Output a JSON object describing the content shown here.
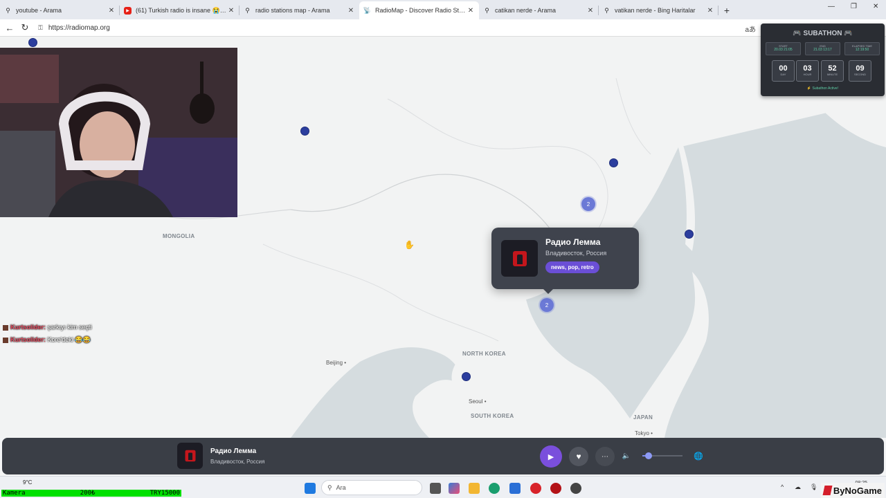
{
  "browser": {
    "tabs": [
      {
        "title": "youtube - Arama",
        "icon": "search-icon",
        "active": false
      },
      {
        "title": "(61) Turkish radio is insane 😭 - Yo",
        "icon": "youtube-icon",
        "active": false
      },
      {
        "title": "radio stations map - Arama",
        "icon": "search-icon",
        "active": false
      },
      {
        "title": "RadioMap - Discover Radio Stations",
        "icon": "radio-icon",
        "active": true
      },
      {
        "title": "catikan nerde - Arama",
        "icon": "search-icon",
        "active": false
      },
      {
        "title": "vatikan nerde - Bing Haritalar",
        "icon": "search-icon",
        "active": false
      }
    ],
    "url": "https://radiomap.org"
  },
  "map": {
    "labels": {
      "mongolia": "MONGOLIA",
      "north_korea": "NORTH KOREA",
      "south_korea": "SOUTH KOREA",
      "japan": "JAPAN",
      "beijing": "Beijing",
      "seoul": "Seoul",
      "tokyo": "Tokyo"
    },
    "clusters": [
      "2",
      "2"
    ]
  },
  "popup": {
    "station_name": "Радио Лемма",
    "location": "Владивосток, Россия",
    "tags": "news, pop, retro"
  },
  "chat": [
    {
      "user": "Kurtsolider:",
      "text": "şarkıyı kim seçti"
    },
    {
      "user": "Kurtsolider:",
      "text": "Kore'deki 😂😂"
    }
  ],
  "subathon": {
    "title": "SUBATHON",
    "start_label": "START",
    "start_value": "20.03 21:05",
    "end_label": "END",
    "end_value": "21.03 13:17",
    "elapsed_label": "ELAPSED TIME",
    "elapsed_value": "12:19:50",
    "counters": [
      {
        "value": "00",
        "unit": "DAY"
      },
      {
        "value": "03",
        "unit": "HOUR"
      },
      {
        "value": "52",
        "unit": "MINUTE"
      },
      {
        "value": "09",
        "unit": "SECOND"
      }
    ],
    "status": "⚡ Subathon Active!"
  },
  "player": {
    "station_name": "Радио Лемма",
    "location": "Владивосток, Россия",
    "volume": 0.15
  },
  "taskbar": {
    "weather_temp": "9°C",
    "search_placeholder": "Ara",
    "clock_time": "08:25"
  },
  "stream_overlay": {
    "camera_label": "Kamera",
    "amount": "200₺",
    "goal": "TRY15000",
    "brand": "ByNoGame"
  }
}
